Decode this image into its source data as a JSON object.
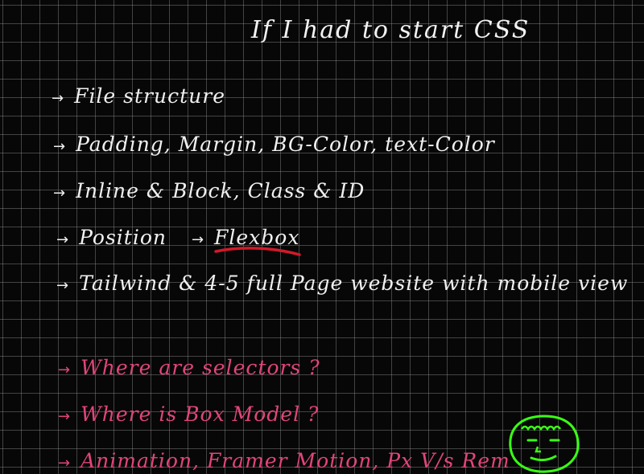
{
  "board": {
    "title": "If I had to start CSS",
    "arrow": "→",
    "items": [
      "File structure",
      "Padding, Margin, BG-Color, text-Color",
      "Inline & Block, Class & ID",
      "Position",
      "Tailwind & 4-5 full Page website with mobile view"
    ],
    "position_next": "Flexbox",
    "questions": [
      "Where are selectors ?",
      "Where is Box Model ?",
      "Animation, Framer Motion, Px V/s Rem"
    ]
  },
  "colors": {
    "background": "#070707",
    "grid": "#8c8c8c",
    "ink_white": "#f0f0f0",
    "ink_pink": "#e0457a",
    "ink_red": "#d11a2a",
    "ink_green": "#39ff14"
  },
  "icons": {
    "face": "smiley-face-doodle-icon"
  }
}
